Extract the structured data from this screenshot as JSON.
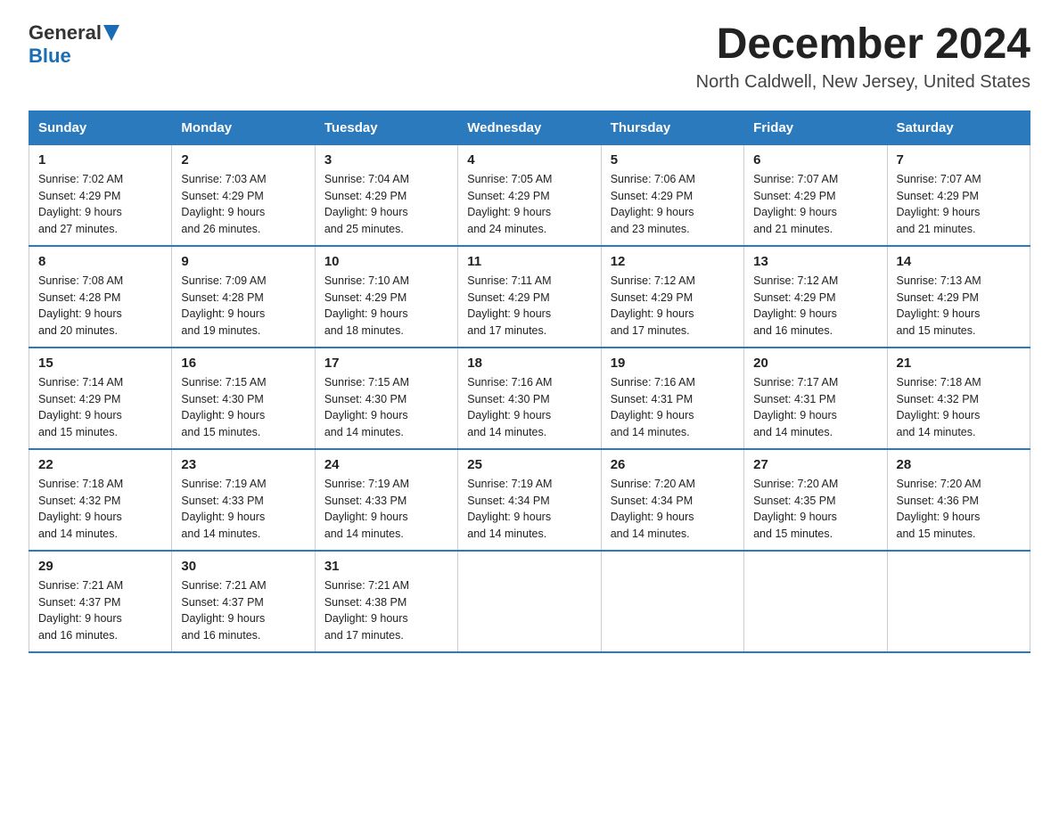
{
  "header": {
    "logo_general": "General",
    "logo_blue": "Blue",
    "month_year": "December 2024",
    "location": "North Caldwell, New Jersey, United States"
  },
  "days_of_week": [
    "Sunday",
    "Monday",
    "Tuesday",
    "Wednesday",
    "Thursday",
    "Friday",
    "Saturday"
  ],
  "weeks": [
    [
      {
        "day": "1",
        "sunrise": "7:02 AM",
        "sunset": "4:29 PM",
        "daylight": "9 hours and 27 minutes."
      },
      {
        "day": "2",
        "sunrise": "7:03 AM",
        "sunset": "4:29 PM",
        "daylight": "9 hours and 26 minutes."
      },
      {
        "day": "3",
        "sunrise": "7:04 AM",
        "sunset": "4:29 PM",
        "daylight": "9 hours and 25 minutes."
      },
      {
        "day": "4",
        "sunrise": "7:05 AM",
        "sunset": "4:29 PM",
        "daylight": "9 hours and 24 minutes."
      },
      {
        "day": "5",
        "sunrise": "7:06 AM",
        "sunset": "4:29 PM",
        "daylight": "9 hours and 23 minutes."
      },
      {
        "day": "6",
        "sunrise": "7:07 AM",
        "sunset": "4:29 PM",
        "daylight": "9 hours and 21 minutes."
      },
      {
        "day": "7",
        "sunrise": "7:07 AM",
        "sunset": "4:29 PM",
        "daylight": "9 hours and 21 minutes."
      }
    ],
    [
      {
        "day": "8",
        "sunrise": "7:08 AM",
        "sunset": "4:28 PM",
        "daylight": "9 hours and 20 minutes."
      },
      {
        "day": "9",
        "sunrise": "7:09 AM",
        "sunset": "4:28 PM",
        "daylight": "9 hours and 19 minutes."
      },
      {
        "day": "10",
        "sunrise": "7:10 AM",
        "sunset": "4:29 PM",
        "daylight": "9 hours and 18 minutes."
      },
      {
        "day": "11",
        "sunrise": "7:11 AM",
        "sunset": "4:29 PM",
        "daylight": "9 hours and 17 minutes."
      },
      {
        "day": "12",
        "sunrise": "7:12 AM",
        "sunset": "4:29 PM",
        "daylight": "9 hours and 17 minutes."
      },
      {
        "day": "13",
        "sunrise": "7:12 AM",
        "sunset": "4:29 PM",
        "daylight": "9 hours and 16 minutes."
      },
      {
        "day": "14",
        "sunrise": "7:13 AM",
        "sunset": "4:29 PM",
        "daylight": "9 hours and 15 minutes."
      }
    ],
    [
      {
        "day": "15",
        "sunrise": "7:14 AM",
        "sunset": "4:29 PM",
        "daylight": "9 hours and 15 minutes."
      },
      {
        "day": "16",
        "sunrise": "7:15 AM",
        "sunset": "4:30 PM",
        "daylight": "9 hours and 15 minutes."
      },
      {
        "day": "17",
        "sunrise": "7:15 AM",
        "sunset": "4:30 PM",
        "daylight": "9 hours and 14 minutes."
      },
      {
        "day": "18",
        "sunrise": "7:16 AM",
        "sunset": "4:30 PM",
        "daylight": "9 hours and 14 minutes."
      },
      {
        "day": "19",
        "sunrise": "7:16 AM",
        "sunset": "4:31 PM",
        "daylight": "9 hours and 14 minutes."
      },
      {
        "day": "20",
        "sunrise": "7:17 AM",
        "sunset": "4:31 PM",
        "daylight": "9 hours and 14 minutes."
      },
      {
        "day": "21",
        "sunrise": "7:18 AM",
        "sunset": "4:32 PM",
        "daylight": "9 hours and 14 minutes."
      }
    ],
    [
      {
        "day": "22",
        "sunrise": "7:18 AM",
        "sunset": "4:32 PM",
        "daylight": "9 hours and 14 minutes."
      },
      {
        "day": "23",
        "sunrise": "7:19 AM",
        "sunset": "4:33 PM",
        "daylight": "9 hours and 14 minutes."
      },
      {
        "day": "24",
        "sunrise": "7:19 AM",
        "sunset": "4:33 PM",
        "daylight": "9 hours and 14 minutes."
      },
      {
        "day": "25",
        "sunrise": "7:19 AM",
        "sunset": "4:34 PM",
        "daylight": "9 hours and 14 minutes."
      },
      {
        "day": "26",
        "sunrise": "7:20 AM",
        "sunset": "4:34 PM",
        "daylight": "9 hours and 14 minutes."
      },
      {
        "day": "27",
        "sunrise": "7:20 AM",
        "sunset": "4:35 PM",
        "daylight": "9 hours and 15 minutes."
      },
      {
        "day": "28",
        "sunrise": "7:20 AM",
        "sunset": "4:36 PM",
        "daylight": "9 hours and 15 minutes."
      }
    ],
    [
      {
        "day": "29",
        "sunrise": "7:21 AM",
        "sunset": "4:37 PM",
        "daylight": "9 hours and 16 minutes."
      },
      {
        "day": "30",
        "sunrise": "7:21 AM",
        "sunset": "4:37 PM",
        "daylight": "9 hours and 16 minutes."
      },
      {
        "day": "31",
        "sunrise": "7:21 AM",
        "sunset": "4:38 PM",
        "daylight": "9 hours and 17 minutes."
      },
      null,
      null,
      null,
      null
    ]
  ]
}
